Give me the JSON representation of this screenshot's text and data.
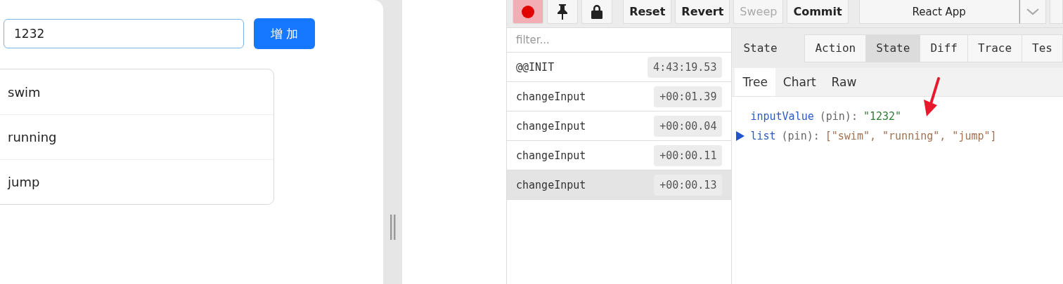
{
  "app": {
    "input": {
      "value": "1232"
    },
    "add_button": "增 加",
    "items": [
      "swim",
      "running",
      "jump"
    ]
  },
  "devtools": {
    "toolbar": {
      "buttons": [
        {
          "kind": "record",
          "on": true
        },
        {
          "kind": "pin",
          "on": false
        },
        {
          "kind": "lock",
          "on": false
        },
        {
          "kind": "text",
          "label": "Reset",
          "disabled": false
        },
        {
          "kind": "text",
          "label": "Revert",
          "disabled": false
        },
        {
          "kind": "text",
          "label": "Sweep",
          "disabled": true
        },
        {
          "kind": "text",
          "label": "Commit",
          "disabled": false
        }
      ],
      "instance": "React App"
    },
    "filter": {
      "placeholder": "filter..."
    },
    "actions": [
      {
        "name": "@@INIT",
        "time": "4:43:19.53",
        "selected": false
      },
      {
        "name": "changeInput",
        "time": "+00:01.39",
        "selected": false
      },
      {
        "name": "changeInput",
        "time": "+00:00.04",
        "selected": false
      },
      {
        "name": "changeInput",
        "time": "+00:00.11",
        "selected": false
      },
      {
        "name": "changeInput",
        "time": "+00:00.13",
        "selected": true
      }
    ],
    "monitor_label": "State",
    "tabs": [
      {
        "label": "Action",
        "selected": false
      },
      {
        "label": "State",
        "selected": true
      },
      {
        "label": "Diff",
        "selected": false
      },
      {
        "label": "Trace",
        "selected": false
      },
      {
        "label": "Tes",
        "selected": false
      }
    ],
    "subtabs": [
      {
        "label": "Tree",
        "selected": true
      },
      {
        "label": "Chart",
        "selected": false
      },
      {
        "label": "Raw",
        "selected": false
      }
    ],
    "tree": [
      {
        "key": "inputValue",
        "meta": "(pin):",
        "value": "\"1232\"",
        "kind": "string",
        "expandable": false
      },
      {
        "key": "list",
        "meta": "(pin):",
        "value": "[\"swim\", \"running\", \"jump\"]",
        "kind": "array",
        "expandable": true
      }
    ]
  }
}
